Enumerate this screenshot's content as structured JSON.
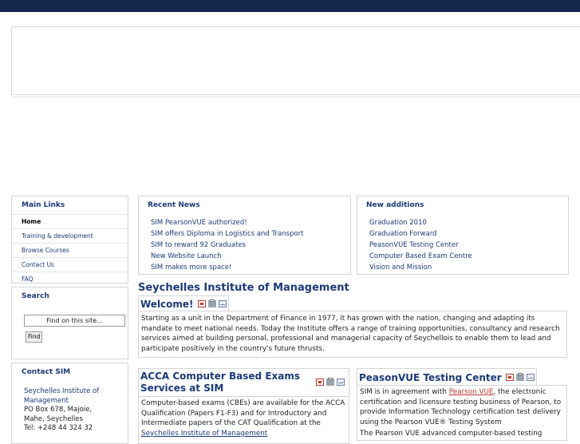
{
  "colors": {
    "topbar": "#15284b",
    "link": "#1b3a78",
    "accent_link": "#c0392b"
  },
  "main_links": {
    "title": "Main Links",
    "items": [
      "Home",
      "Training & development",
      "Browse Courses",
      "Contact Us",
      "FAQ"
    ]
  },
  "search": {
    "title": "Search",
    "placeholder": "Find on this site...",
    "button": "Find"
  },
  "contact": {
    "title": "Contact SIM",
    "org_line1": "Seychelles Institute of",
    "org_line2": "Management",
    "address1": "PO Box 678, Majoie,",
    "address2": "Mahe, Seychelles",
    "tel": "Tel: +248 44 324 32"
  },
  "recent_news": {
    "title": "Recent News",
    "items": [
      "SIM PearsonVUE authorized!",
      "SIM offers Diploma in Logistics and Transport",
      "SIM to reward 92 Graduates",
      "New Website Launch",
      "SIM makes more space!"
    ]
  },
  "new_additions": {
    "title": "New additions",
    "items": [
      "Graduation 2010",
      "Graduation Forward",
      "PeasonVUE Testing Center",
      "Computer Based Exam Centre",
      "Vision and Mission"
    ]
  },
  "page_title": "Seychelles Institute of Management",
  "welcome": {
    "title": "Welcome!",
    "body": "Starting as a unit in the Department of Finance in 1977, it has grown with the nation, changing and adapting its mandate to meet national needs. Today the Institute offers a range of training opportunities, consultancy and research services aimed at building personal, professional and managerial capacity of Seychellois to enable them to lead and participate positively in the country's future thrusts."
  },
  "acca": {
    "title": "ACCA Computer Based Exams Services at SIM",
    "body": "Computer-based exams (CBEs) are available for the ACCA Qualification (Papers F1-F3) and for Introductory and Intermediate papers of the CAT Qualification at the",
    "link": "Seychelles Institute of Management"
  },
  "vue": {
    "title": "PeasonVUE Testing Center",
    "body_before": "SIM is in agreement with ",
    "link": "Pearson VUE",
    "body_after": ", the electronic certification and licensure testing business of Pearson, to provide Information Technology certification test delivery using the Pearson VUE® Testing System",
    "body2": "The Pearson VUE advanced computer-based testing system"
  },
  "icons": [
    "pdf-icon",
    "print-icon",
    "email-icon"
  ]
}
